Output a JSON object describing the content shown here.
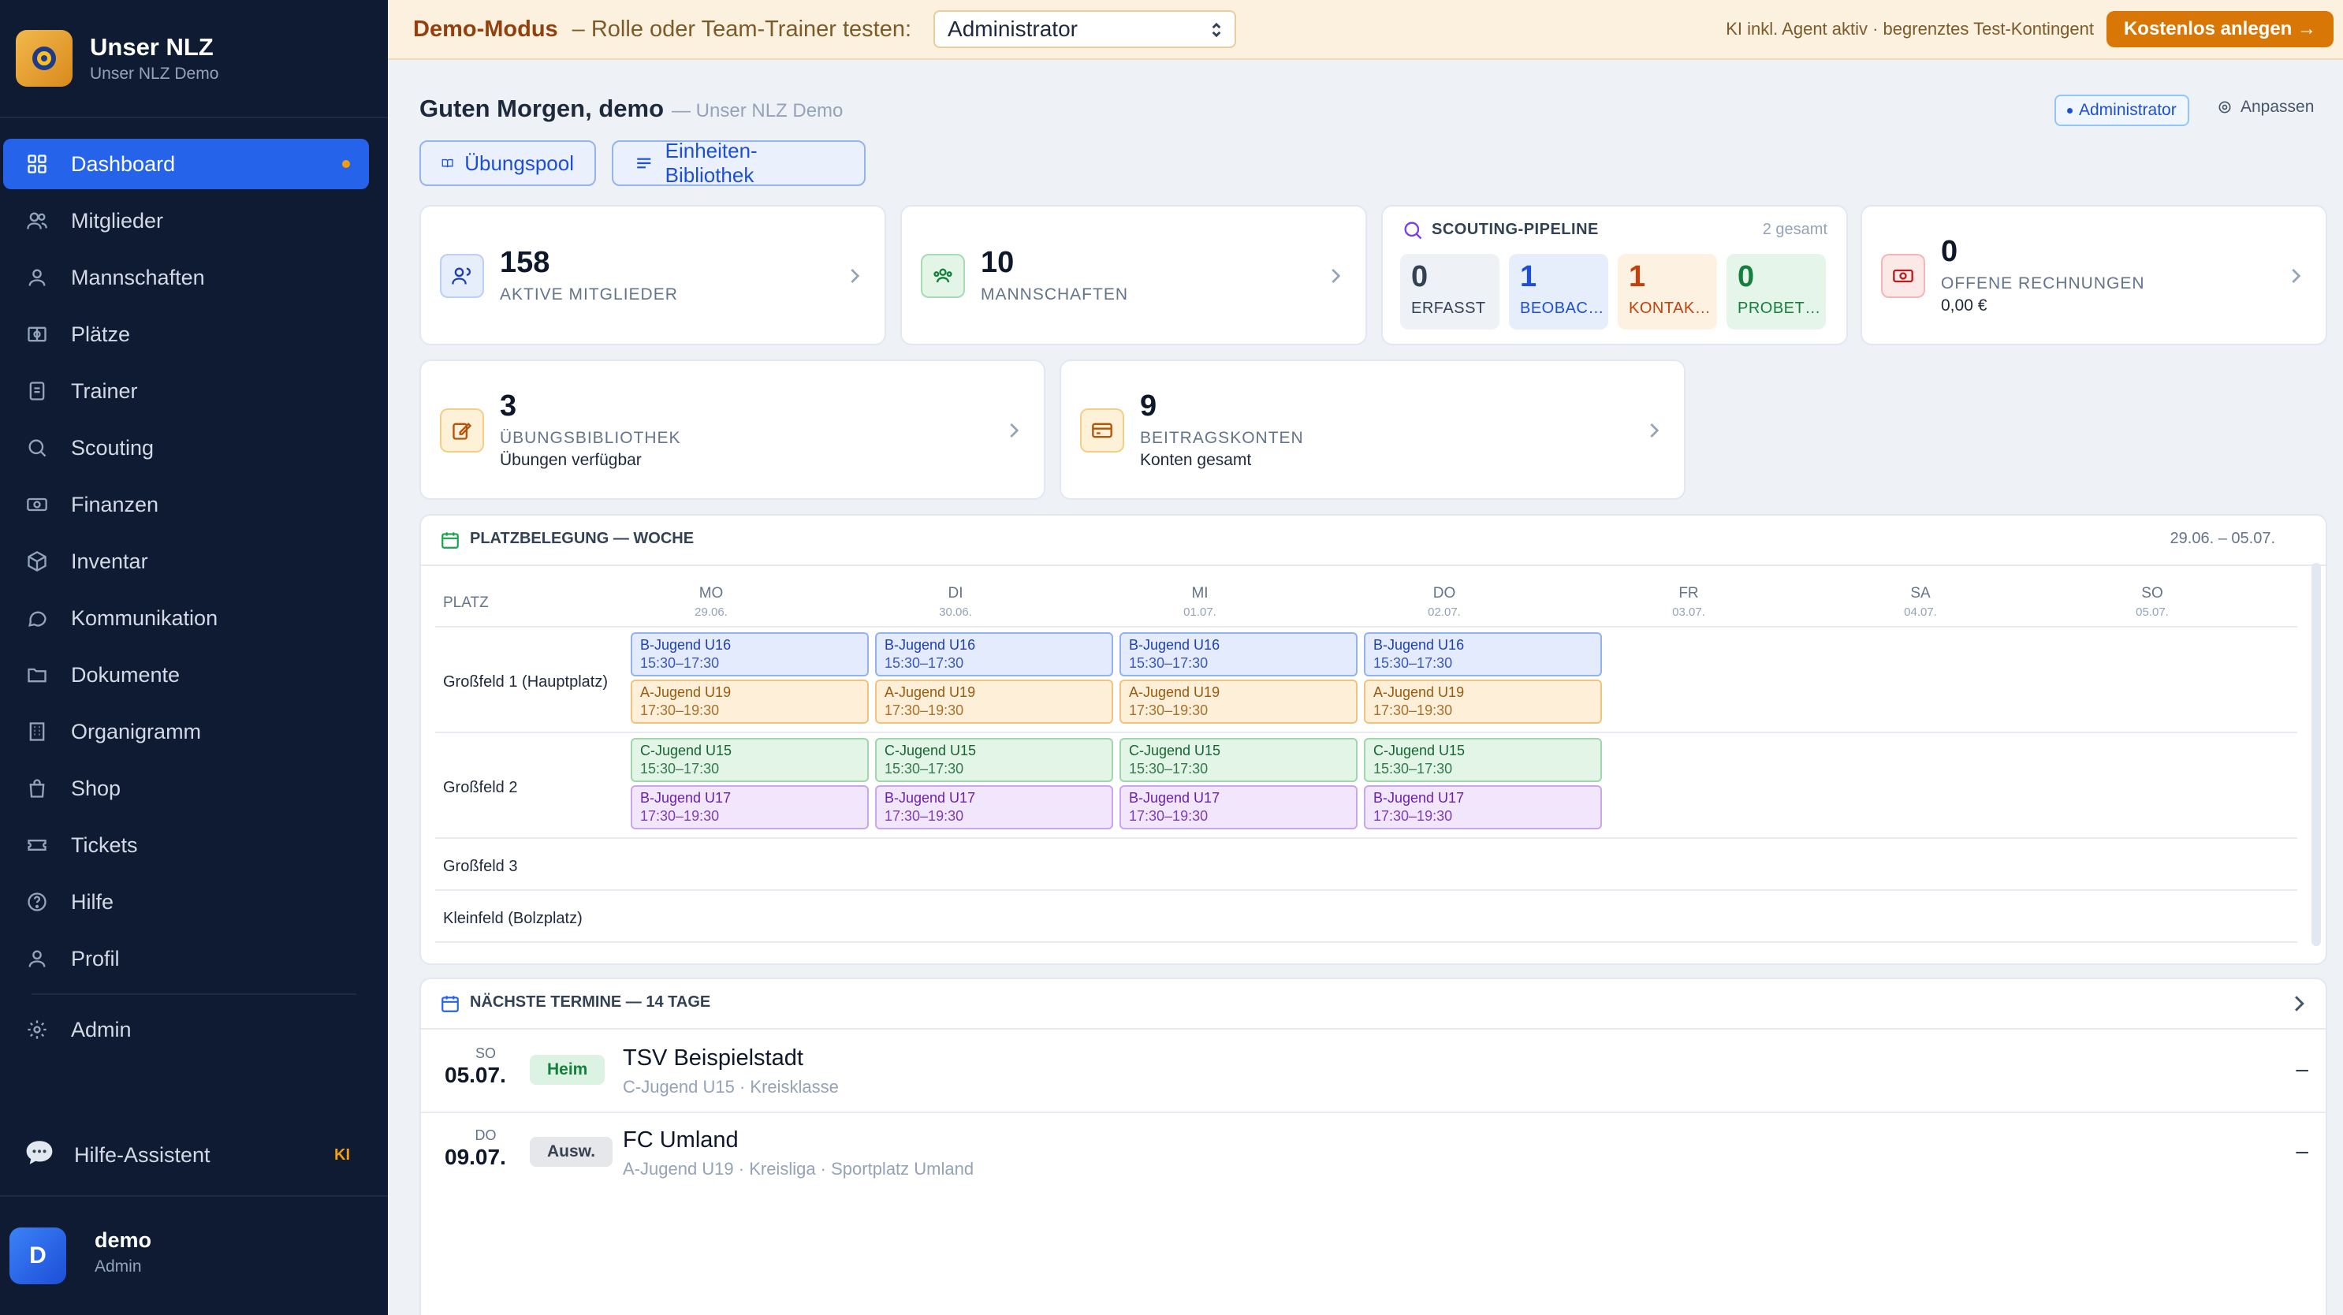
{
  "brand": {
    "title": "Unser NLZ",
    "subtitle": "Unser NLZ Demo"
  },
  "nav": [
    {
      "label": "Dashboard",
      "icon": "grid-icon",
      "active": true
    },
    {
      "label": "Mitglieder",
      "icon": "users-icon"
    },
    {
      "label": "Mannschaften",
      "icon": "user-icon"
    },
    {
      "label": "Plätze",
      "icon": "field-icon"
    },
    {
      "label": "Trainer",
      "icon": "clipboard-icon"
    },
    {
      "label": "Scouting",
      "icon": "search-icon"
    },
    {
      "label": "Finanzen",
      "icon": "money-icon"
    },
    {
      "label": "Inventar",
      "icon": "box-icon"
    },
    {
      "label": "Kommunikation",
      "icon": "chat-icon"
    },
    {
      "label": "Dokumente",
      "icon": "folder-icon"
    },
    {
      "label": "Organigramm",
      "icon": "building-icon"
    },
    {
      "label": "Shop",
      "icon": "bag-icon"
    },
    {
      "label": "Tickets",
      "icon": "ticket-icon"
    },
    {
      "label": "Hilfe",
      "icon": "help-icon"
    },
    {
      "label": "Profil",
      "icon": "user-icon"
    }
  ],
  "admin_label": "Admin",
  "assistant": {
    "label": "Hilfe-Assistent",
    "badge": "KI"
  },
  "user": {
    "initial": "D",
    "name": "demo",
    "role": "Admin"
  },
  "topbar": {
    "mode": "Demo-Modus",
    "desc": "– Rolle oder Team-Trainer testen:",
    "role_value": "Administrator",
    "status": "KI inkl. Agent aktiv · begrenztes Test-Kontingent",
    "cta": "Kostenlos anlegen →"
  },
  "header": {
    "greeting": "Guten Morgen, demo",
    "club": "— Unser NLZ Demo",
    "role_badge": "Administrator",
    "customize": "Anpassen",
    "quick1": "Übungspool",
    "quick2": "Einheiten-Bibliothek"
  },
  "stats": {
    "members": {
      "value": "158",
      "label": "AKTIVE MITGLIEDER"
    },
    "teams": {
      "value": "10",
      "label": "MANNSCHAFTEN"
    },
    "invoices": {
      "value": "0",
      "label": "OFFENE RECHNUNGEN",
      "sub": "0,00 €"
    },
    "exercises": {
      "value": "3",
      "label": "ÜBUNGSBIBLIOTHEK",
      "sub": "Übungen verfügbar"
    },
    "accounts": {
      "value": "9",
      "label": "BEITRAGSKONTEN",
      "sub": "Konten gesamt"
    }
  },
  "scouting": {
    "title": "SCOUTING-PIPELINE",
    "total": "2 gesamt",
    "stages": [
      {
        "value": "0",
        "label": "ERFASST",
        "color": "#334155"
      },
      {
        "value": "1",
        "label": "BEOBAC…",
        "color": "#1d4ed8"
      },
      {
        "value": "1",
        "label": "KONTAK…",
        "color": "#c2410c"
      },
      {
        "value": "0",
        "label": "PROBET…",
        "color": "#15803d"
      }
    ]
  },
  "schedule": {
    "title": "PLATZBELEGUNG — WOCHE",
    "range": "29.06. – 05.07.",
    "platz_header": "PLATZ",
    "days": [
      {
        "d": "MO",
        "dt": "29.06."
      },
      {
        "d": "DI",
        "dt": "30.06."
      },
      {
        "d": "MI",
        "dt": "01.07."
      },
      {
        "d": "DO",
        "dt": "02.07."
      },
      {
        "d": "FR",
        "dt": "03.07."
      },
      {
        "d": "SA",
        "dt": "04.07."
      },
      {
        "d": "SO",
        "dt": "05.07."
      }
    ],
    "fields": [
      "Großfeld 1 (Hauptplatz)",
      "Großfeld 2",
      "Großfeld 3",
      "Kleinfeld (Bolzplatz)"
    ],
    "bookings": [
      {
        "team": "B-Jugend U16",
        "time": "15:30–17:30"
      },
      {
        "team": "A-Jugend U19",
        "time": "17:30–19:30"
      },
      {
        "team": "C-Jugend U15",
        "time": "15:30–17:30"
      },
      {
        "team": "B-Jugend U17",
        "time": "17:30–19:30"
      }
    ]
  },
  "upcoming": {
    "title": "NÄCHSTE TERMINE — 14 TAGE",
    "events": [
      {
        "wd": "SO",
        "date": "05.07.",
        "badge": "Heim",
        "title": "TSV Beispielstadt",
        "sub": "C-Jugend U15 · Kreisklasse",
        "result": "–"
      },
      {
        "wd": "DO",
        "date": "09.07.",
        "badge": "Ausw.",
        "title": "FC Umland",
        "sub": "A-Jugend U19 · Kreisliga · Sportplatz Umland",
        "result": "–"
      }
    ]
  }
}
